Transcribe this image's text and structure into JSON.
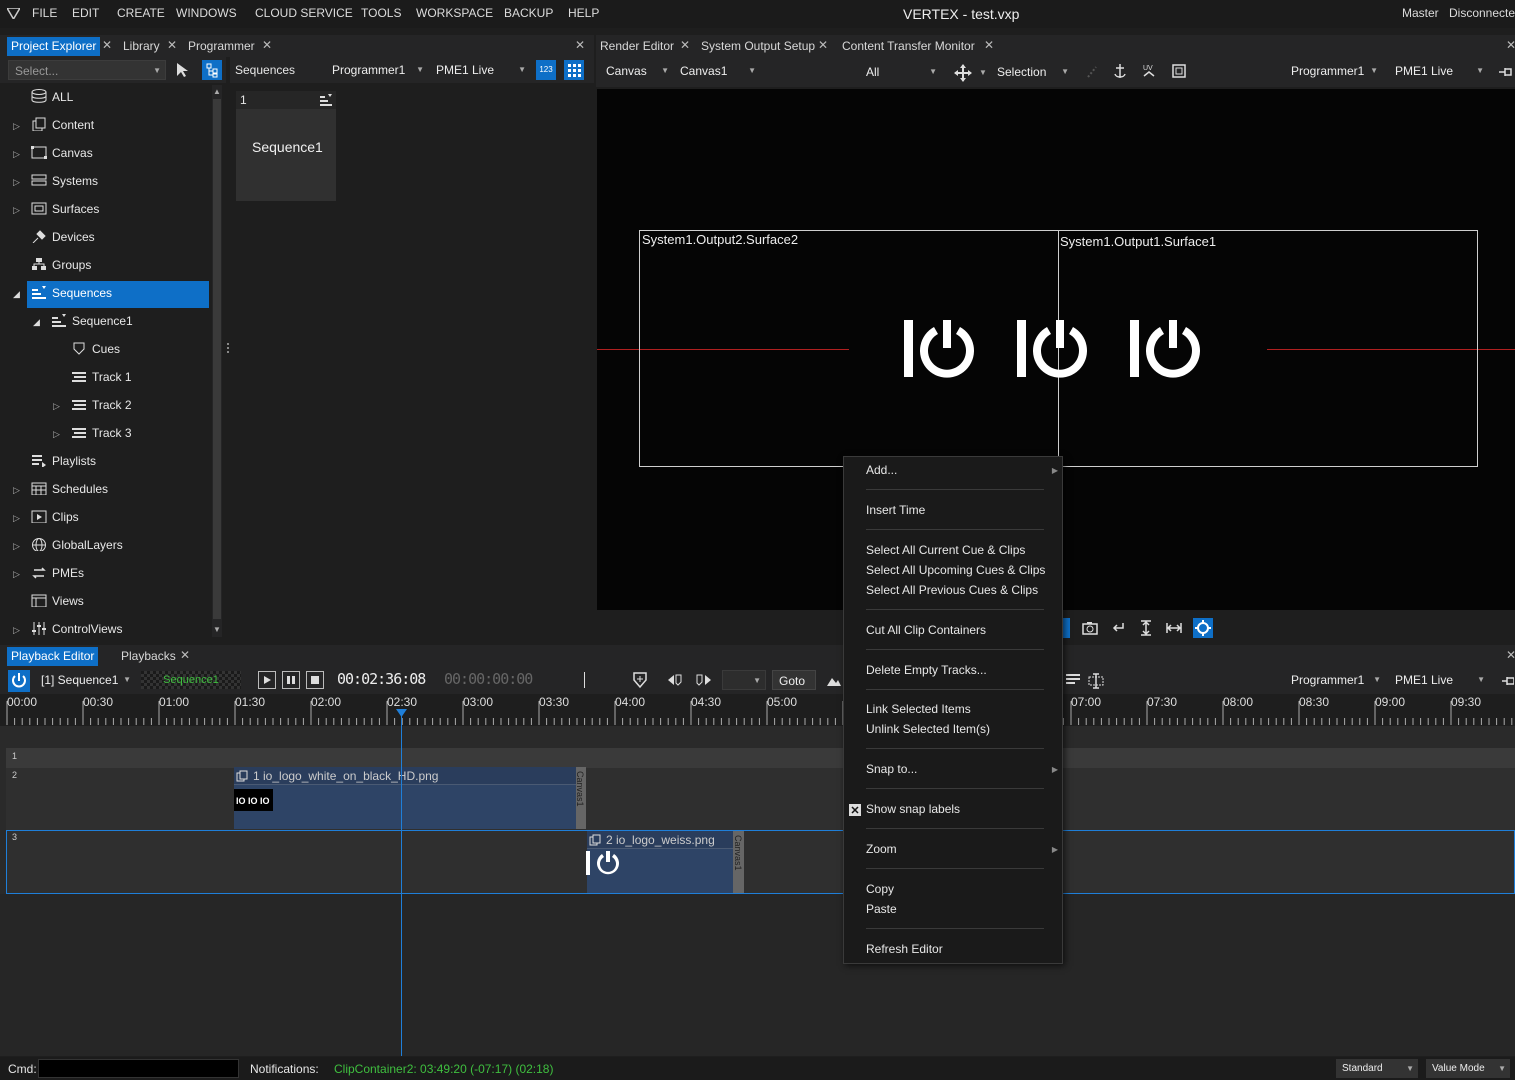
{
  "menu": {
    "items": [
      "FILE",
      "EDIT",
      "CREATE",
      "WINDOWS",
      "CLOUD SERVICE",
      "TOOLS",
      "WORKSPACE",
      "BACKUP",
      "HELP"
    ],
    "title": "VERTEX - test.vxp",
    "master": "Master",
    "status": "Disconnecte"
  },
  "left_tabs": [
    "Project Explorer",
    "Library",
    "Programmer"
  ],
  "explorer": {
    "select_placeholder": "Select...",
    "items": [
      "ALL",
      "Content",
      "Canvas",
      "Systems",
      "Surfaces",
      "Devices",
      "Groups",
      "Sequences",
      "Sequence1",
      "Cues",
      "Track 1",
      "Track 2",
      "Track 3",
      "Playlists",
      "Schedules",
      "Clips",
      "GlobalLayers",
      "PMEs",
      "Views",
      "ControlViews"
    ]
  },
  "sequences_panel": {
    "label": "Sequences",
    "programmer": "Programmer1",
    "pme": "PME1 Live",
    "badge": "123",
    "tile_number": "1",
    "tile_name": "Sequence1"
  },
  "render_tabs": [
    "Render Editor",
    "System Output Setup",
    "Content Transfer Monitor"
  ],
  "render_toolbar": {
    "canvas_label": "Canvas",
    "canvas": "Canvas1",
    "filter": "All",
    "mode": "Selection",
    "programmer": "Programmer1",
    "pme": "PME1 Live"
  },
  "viewport": {
    "surface2": "System1.Output2.Surface2",
    "surface1": "System1.Output1.Surface1"
  },
  "bottom_tabs": [
    "Playback Editor",
    "Playbacks"
  ],
  "playback": {
    "sequence": "[1] Sequence1",
    "seq_badge": "Sequence1",
    "timecode": "00:02:36:08",
    "timecode2": "00:00:00:00",
    "goto": "Goto",
    "programmer": "Programmer1",
    "pme": "PME1 Live",
    "ruler": [
      "00:00",
      "00:30",
      "01:00",
      "01:30",
      "02:00",
      "02:30",
      "03:00",
      "03:30",
      "04:00",
      "04:30",
      "05:00",
      "07:00",
      "07:30",
      "08:00",
      "08:30",
      "09:00",
      "09:30"
    ],
    "tracks": [
      "1",
      "2",
      "3"
    ],
    "clip1": "1 io_logo_white_on_black_HD.png",
    "clip2": "2 io_logo_weiss.png",
    "container": "Canvas1"
  },
  "context_menu": {
    "add": "Add...",
    "insert_time": "Insert Time",
    "sel_current": "Select All Current Cue & Clips",
    "sel_upcoming": "Select All Upcoming Cues & Clips",
    "sel_previous": "Select All Previous Cues & Clips",
    "cut_all": "Cut All Clip Containers",
    "delete_empty": "Delete Empty Tracks...",
    "link": "Link Selected Items",
    "unlink": "Unlink Selected Item(s)",
    "snap_to": "Snap to...",
    "show_snap": "Show snap labels",
    "zoom": "Zoom",
    "copy": "Copy",
    "paste": "Paste",
    "refresh": "Refresh Editor"
  },
  "statusbar": {
    "cmd": "Cmd:",
    "notifications": "Notifications:",
    "message": "ClipContainer2: 03:49:20 (-07:17) (02:18)",
    "standard": "Standard",
    "value_mode": "Value Mode"
  },
  "colors": {
    "accent": "#0e6fc7",
    "green": "#3fbf3f",
    "clip": "#2e4466",
    "red": "#b02020"
  }
}
